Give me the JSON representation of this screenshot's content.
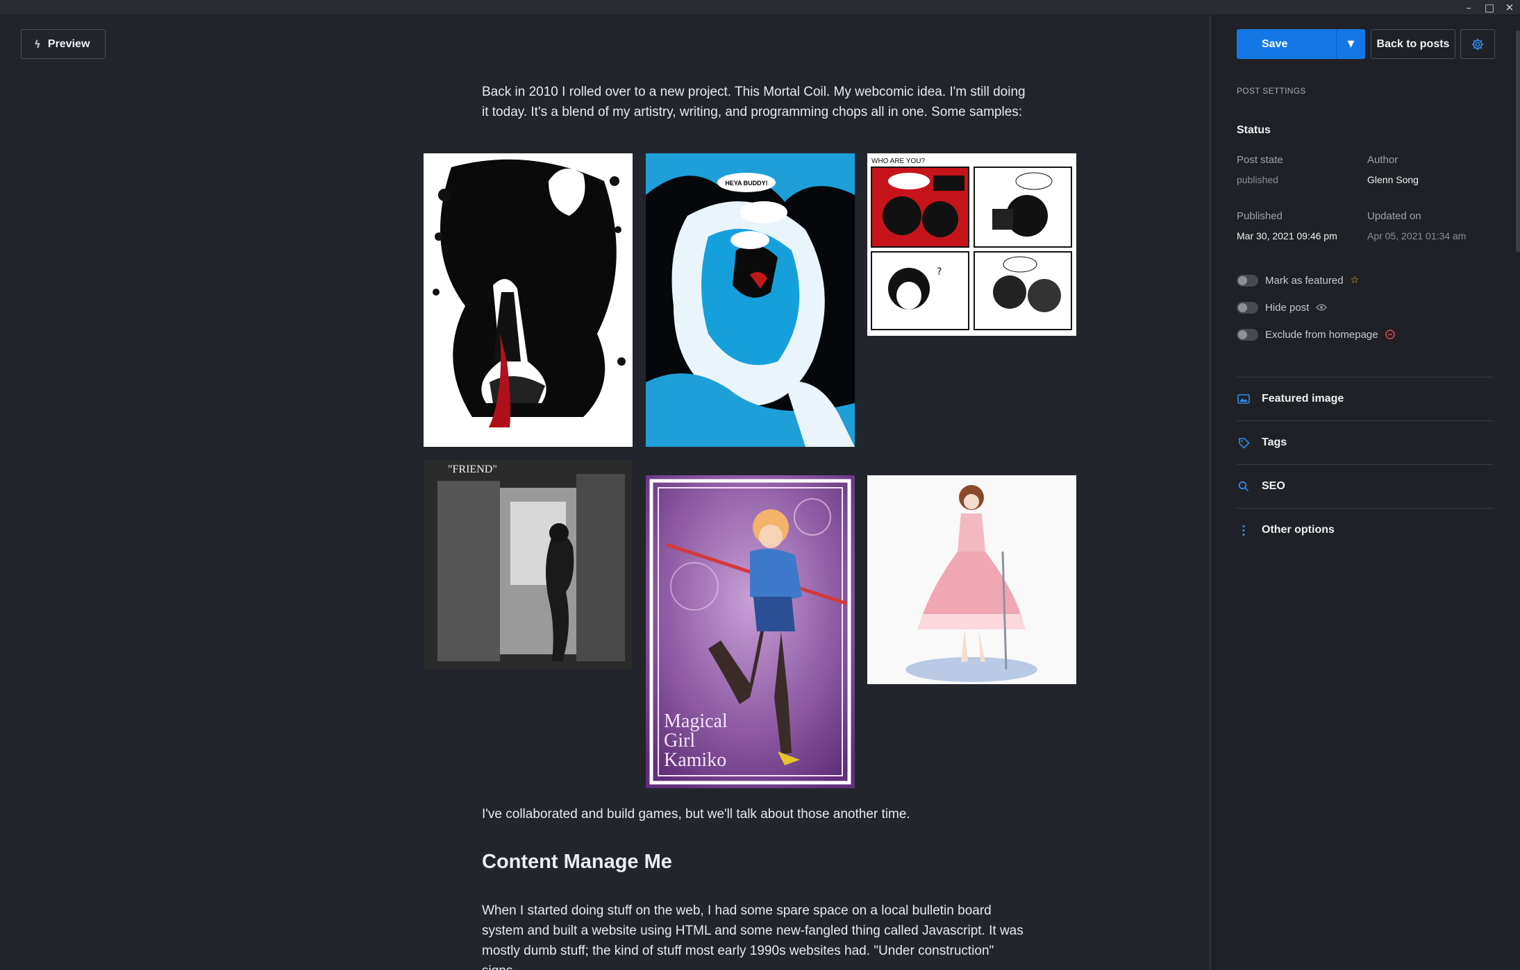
{
  "window": {
    "controls": [
      "–",
      "□",
      "✕"
    ]
  },
  "editor": {
    "preview_label": "Preview",
    "intro_paragraph": "Back in 2010 I rolled over to a new project. This Mortal Coil. My webcomic idea. I'm still doing it today. It's a blend of my artistry, writing, and programming chops all in one. Some samples:",
    "gallery": [
      {
        "name": "ink-illustration-girl-splatter",
        "comic_signature": ""
      },
      {
        "name": "blue-monster-comic-panel",
        "speech": "HEYA BUDDY!"
      },
      {
        "name": "who-are-you-comic-strip",
        "caption": "WHO ARE YOU?"
      },
      {
        "name": "friend-vending-machine-illustration",
        "caption": "\"FRIEND\""
      },
      {
        "name": "magical-girl-kamiko-poster",
        "caption": "Magical Girl Kamiko"
      },
      {
        "name": "pink-dress-illustration",
        "caption": ""
      }
    ],
    "after_gallery_paragraph": "I've collaborated and build games, but we'll talk about those another time.",
    "heading": "Content Manage Me",
    "body_paragraph": "When I started doing stuff on the web, I had some spare space on a local bulletin board system and built a website using HTML and some new-fangled thing called Javascript. It was mostly dumb stuff; the kind of stuff most early 1990s websites had. \"Under construction\" signs."
  },
  "sidebar": {
    "save_label": "Save",
    "back_label": "Back to posts",
    "section_label": "POST SETTINGS",
    "status_heading": "Status",
    "post_state_label": "Post state",
    "post_state_value": "published",
    "author_label": "Author",
    "author_value": "Glenn Song",
    "published_label": "Published",
    "published_value": "Mar 30, 2021 09:46 pm",
    "updated_label": "Updated on",
    "updated_value": "Apr 05, 2021 01:34 am",
    "toggles": [
      {
        "label": "Mark as featured",
        "icon": "star-icon",
        "on": false
      },
      {
        "label": "Hide post",
        "icon": "eye-icon",
        "on": false
      },
      {
        "label": "Exclude from homepage",
        "icon": "minus-circle-icon",
        "on": false
      }
    ],
    "panels": [
      {
        "label": "Featured image",
        "icon": "image-icon"
      },
      {
        "label": "Tags",
        "icon": "tag-icon"
      },
      {
        "label": "SEO",
        "icon": "search-icon"
      },
      {
        "label": "Other options",
        "icon": "more-vertical-icon"
      }
    ]
  },
  "colors": {
    "accent": "#1377e6",
    "background": "#23252d",
    "sidebar": "#1f2127",
    "star": "#f5c518",
    "exclude": "#e5484d"
  }
}
